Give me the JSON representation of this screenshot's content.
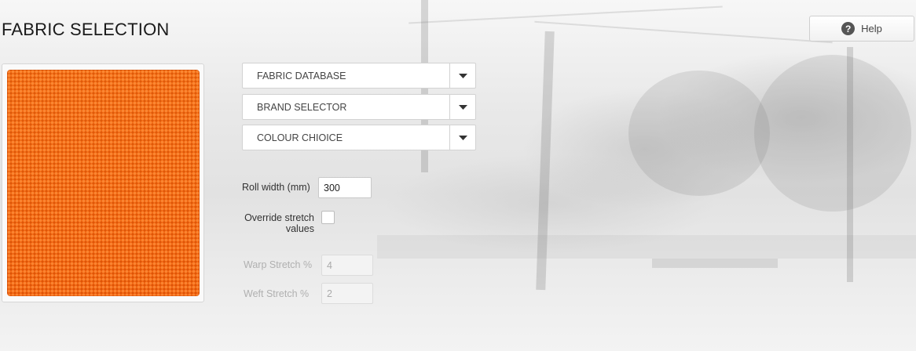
{
  "page": {
    "title": "FABRIC SELECTION"
  },
  "help": {
    "label": "Help",
    "icon": "help-icon"
  },
  "swatch": {
    "color": "#f4660c",
    "description_icon": "fabric-swatch"
  },
  "selects": {
    "fabric_database": "FABRIC DATABASE",
    "brand_selector": "BRAND SELECTOR",
    "colour_choice": "COLOUR CHIOICE",
    "arrow_icon": "caret-down-icon"
  },
  "roll_width": {
    "label": "Roll width (mm)",
    "value": "300"
  },
  "override_stretch": {
    "label_line1": "Override stretch",
    "label_line2": "values",
    "checked": false
  },
  "warp_stretch": {
    "label": "Warp Stretch %",
    "value": "4"
  },
  "weft_stretch": {
    "label": "Weft Stretch %",
    "value": "2"
  }
}
